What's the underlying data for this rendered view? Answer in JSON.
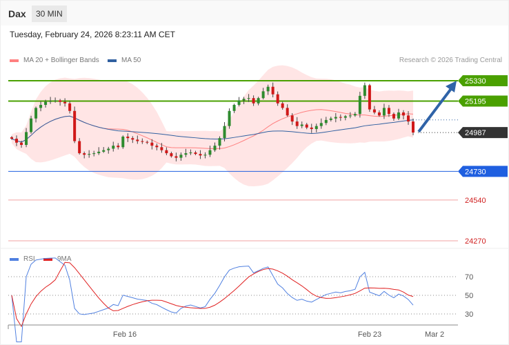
{
  "header": {
    "symbol": "Dax",
    "timeframe": "30 MIN",
    "datetime": "Tuesday, February 24, 2026 8:23:11 AM CET"
  },
  "legend": {
    "bb": "MA 20 + Bollinger Bands",
    "ma50": "MA 50",
    "rsi": "RSI",
    "ma9": "9MA",
    "credit": "Research © 2026 Trading Central"
  },
  "colors": {
    "up": "#2e8b2e",
    "down": "#d01818",
    "bb": "#ff8080",
    "ma50": "#3060a0",
    "resistance": "#4aa000",
    "support": "#1f5fe0",
    "last": "#333333",
    "arrow": "#2f63a8",
    "rsi": "#5080e0",
    "rsima": "#e02020"
  },
  "chart_data": {
    "type": "candlestick",
    "ylim": [
      24270,
      25330
    ],
    "levels": [
      {
        "label": "25330",
        "value": 25330,
        "kind": "resistance"
      },
      {
        "label": "25195",
        "value": 25195,
        "kind": "resistance"
      },
      {
        "label": "24987",
        "value": 24987,
        "kind": "last"
      },
      {
        "label": "24730",
        "value": 24730,
        "kind": "support"
      },
      {
        "label": "24540",
        "value": 24540,
        "kind": "minor"
      },
      {
        "label": "24270",
        "value": 24270,
        "kind": "minor"
      }
    ],
    "closes": [
      24946,
      24920,
      24905,
      24990,
      25080,
      25150,
      25170,
      25190,
      25195,
      25200,
      25190,
      25180,
      25130,
      24930,
      24850,
      24840,
      24845,
      24850,
      24860,
      24870,
      24880,
      24900,
      24890,
      24960,
      24950,
      24940,
      24930,
      24925,
      24920,
      24900,
      24890,
      24870,
      24850,
      24830,
      24820,
      24840,
      24850,
      24855,
      24845,
      24835,
      24840,
      24870,
      24900,
      24950,
      25030,
      25130,
      25170,
      25200,
      25210,
      25215,
      25180,
      25215,
      25260,
      25290,
      25240,
      25180,
      25150,
      25100,
      25060,
      25030,
      25040,
      25020,
      25010,
      25030,
      25050,
      25070,
      25080,
      25090,
      25085,
      25095,
      25100,
      25110,
      25230,
      25300,
      25140,
      25120,
      25100,
      25150,
      25110,
      25080,
      25120,
      25100,
      25060,
      24987
    ],
    "rsi_ticks": [
      "70",
      "50",
      "30"
    ],
    "x_ticks": [
      "Feb 16",
      "Feb 23",
      "Mar 2"
    ]
  }
}
